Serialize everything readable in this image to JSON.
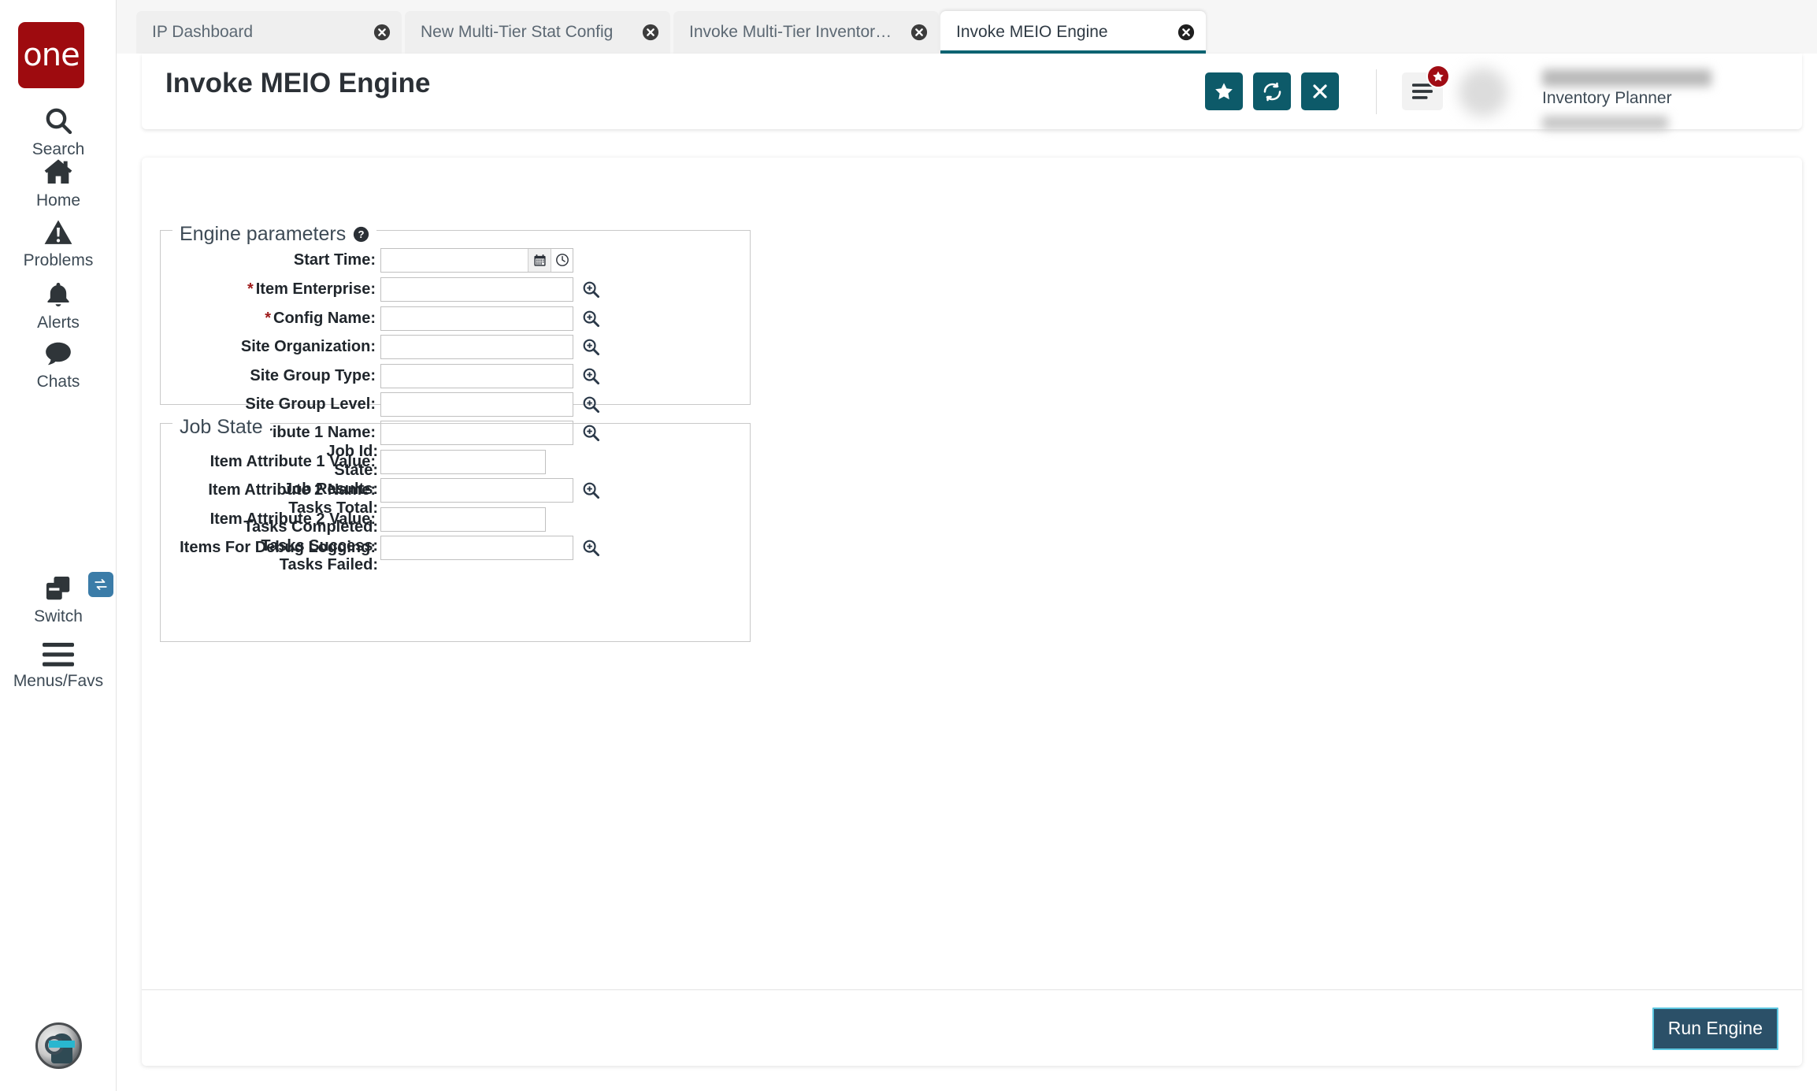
{
  "brand": {
    "logo_text": "one"
  },
  "sidebar": {
    "items": [
      {
        "label": "Search",
        "icon": "search-icon"
      },
      {
        "label": "Home",
        "icon": "home-icon"
      },
      {
        "label": "Problems",
        "icon": "warning-triangle-icon"
      },
      {
        "label": "Alerts",
        "icon": "bell-icon"
      },
      {
        "label": "Chats",
        "icon": "chat-bubble-icon"
      },
      {
        "label": "Switch",
        "icon": "windows-switch-icon"
      },
      {
        "label": "Menus/Favs",
        "icon": "hamburger-icon"
      }
    ],
    "assistant_avatar": "robot-assistant-avatar"
  },
  "tabs": [
    {
      "label": "IP Dashboard",
      "active": false
    },
    {
      "label": "New Multi-Tier Stat Config",
      "active": false
    },
    {
      "label": "Invoke Multi-Tier Inventory Plan...",
      "active": false
    },
    {
      "label": "Invoke MEIO Engine",
      "active": true
    }
  ],
  "header": {
    "title": "Invoke MEIO Engine",
    "actions": [
      {
        "name": "favorite-button",
        "icon": "star-icon"
      },
      {
        "name": "refresh-button",
        "icon": "refresh-icon"
      },
      {
        "name": "close-button",
        "icon": "close-x-icon"
      }
    ],
    "menu_button_icon": "hamburger-icon",
    "menu_badge_icon": "star-icon",
    "user_role": "Inventory Planner",
    "dropdown_icon": "chevron-down-icon"
  },
  "engine_parameters": {
    "legend": "Engine parameters",
    "help_icon": "question-circle-icon",
    "fields": [
      {
        "label": "Start Time:",
        "required": false,
        "value": "",
        "control": "datetime",
        "width": "wide"
      },
      {
        "label": "Item Enterprise:",
        "required": true,
        "value": "",
        "control": "picker",
        "width": "wide"
      },
      {
        "label": "Config Name:",
        "required": true,
        "value": "",
        "control": "picker",
        "width": "wide"
      },
      {
        "label": "Site Organization:",
        "required": false,
        "value": "",
        "control": "picker",
        "width": "wide"
      },
      {
        "label": "Site Group Type:",
        "required": false,
        "value": "",
        "control": "picker",
        "width": "wide"
      },
      {
        "label": "Site Group Level:",
        "required": false,
        "value": "",
        "control": "picker",
        "width": "wide"
      },
      {
        "label": "Item Attribute 1 Name:",
        "required": false,
        "value": "",
        "control": "picker",
        "width": "wide"
      },
      {
        "label": "Item Attribute 1 Value:",
        "required": false,
        "value": "",
        "control": "text",
        "width": "narrow"
      },
      {
        "label": "Item Attribute 2 Name:",
        "required": false,
        "value": "",
        "control": "picker",
        "width": "wide"
      },
      {
        "label": "Item Attribute 2 Value:",
        "required": false,
        "value": "",
        "control": "text",
        "width": "narrow"
      },
      {
        "label": "Items For Debug Logging:",
        "required": false,
        "value": "",
        "control": "picker",
        "width": "wide"
      }
    ]
  },
  "job_state": {
    "legend": "Job State",
    "rows": [
      {
        "label": "Job Id:",
        "value": ""
      },
      {
        "label": "State:",
        "value": ""
      },
      {
        "label": "Job Results:",
        "value": ""
      },
      {
        "label": "Tasks Total:",
        "value": ""
      },
      {
        "label": "Tasks Completed:",
        "value": ""
      },
      {
        "label": "Tasks Success:",
        "value": ""
      },
      {
        "label": "Tasks Failed:",
        "value": ""
      }
    ]
  },
  "footer": {
    "run_button_label": "Run Engine"
  },
  "colors": {
    "brand_red": "#9e0b0f",
    "accent_teal": "#0d5a69",
    "active_tab_underline": "#0d6472",
    "run_button_bg": "#2b5068",
    "run_button_border": "#5bc6e0",
    "required_star": "#9e1b1b",
    "badge_red": "#a00c14",
    "switch_badge_blue": "#3b7ca8"
  }
}
